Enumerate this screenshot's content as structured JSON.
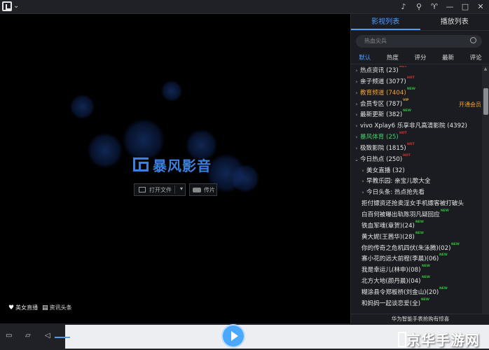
{
  "sidebar": {
    "tabs": [
      "影视列表",
      "播放列表"
    ],
    "search_placeholder": "热血尖兵",
    "filters": [
      "默认",
      "热度",
      "评分",
      "最新",
      "评论"
    ],
    "items": [
      {
        "label": "热点资讯 (23)",
        "arrow": "›",
        "badge": "HOT",
        "badge_type": "hot",
        "indent": 0
      },
      {
        "label": "亲子频道 (3077)",
        "arrow": "›",
        "badge": "HOT",
        "badge_type": "hot",
        "indent": 0
      },
      {
        "label": "教育频道 (7404)",
        "arrow": "›",
        "badge": "NEW",
        "badge_type": "new",
        "indent": 0,
        "color": "#f0a030"
      },
      {
        "label": "会员专区 (787)",
        "arrow": "›",
        "badge": "VIP",
        "badge_type": "vip",
        "indent": 0,
        "extra": "开通会员"
      },
      {
        "label": "最新更新 (382)",
        "arrow": "›",
        "badge": "NEW",
        "badge_type": "new",
        "indent": 0
      },
      {
        "label": "vivo Xplay6 乐享非凡高清影院 (4392)",
        "arrow": "›",
        "indent": 0
      },
      {
        "label": "暴风体育 (25)",
        "arrow": "›",
        "badge": "HOT",
        "badge_type": "hot",
        "indent": 0,
        "color": "#3fd16a"
      },
      {
        "label": "极致影院 (1815)",
        "arrow": "›",
        "badge": "HOT",
        "badge_type": "hot",
        "indent": 0
      },
      {
        "label": "今日热点 (250)",
        "arrow": "⌄",
        "badge": "HOT",
        "badge_type": "hot",
        "indent": 0
      },
      {
        "label": "美女直播 (32)",
        "arrow": "›",
        "indent": 1
      },
      {
        "label": "早教乐园: 亲宝儿歌大全",
        "arrow": "›",
        "indent": 1
      },
      {
        "label": "今日头条: 热点抢先看",
        "arrow": "›",
        "indent": 1
      },
      {
        "label": "拒付嫖资还抢卖淫女手机嫖客被打破头",
        "arrow": "",
        "indent": 2
      },
      {
        "label": "白百何被曝出轨陈羽凡疑回应",
        "arrow": "",
        "badge": "NEW",
        "badge_type": "new",
        "indent": 2
      },
      {
        "label": "铁血军魂(章贺)(24)",
        "arrow": "",
        "badge": "NEW",
        "badge_type": "new",
        "indent": 2
      },
      {
        "label": "黄大妮(王茜华)(28)",
        "arrow": "",
        "badge": "NEW",
        "badge_type": "new",
        "indent": 2
      },
      {
        "label": "你的传奇之危机四伏(朱泳腾)(02)",
        "arrow": "",
        "badge": "NEW",
        "badge_type": "new",
        "indent": 2
      },
      {
        "label": "寡小花的远大前程(李晨)(06)",
        "arrow": "",
        "badge": "NEW",
        "badge_type": "new",
        "indent": 2
      },
      {
        "label": "我是幸运儿(林申)(08)",
        "arrow": "",
        "badge": "NEW",
        "badge_type": "new",
        "indent": 2
      },
      {
        "label": "北方大地(颜丹晨)(04)",
        "arrow": "",
        "badge": "NEW",
        "badge_type": "new",
        "indent": 2
      },
      {
        "label": "糊涂县令郑板桥(刘金山)(20)",
        "arrow": "",
        "badge": "NEW",
        "badge_type": "new",
        "indent": 2
      },
      {
        "label": "和妈妈一起谈恋爱(全)",
        "arrow": "",
        "badge": "NEW",
        "badge_type": "new",
        "indent": 2
      }
    ],
    "promo": "华为智能手表抢购有惊喜"
  },
  "player": {
    "brand": "暴风影音",
    "open_file": "打开文件",
    "clip": "传片",
    "links": [
      "美女直播",
      "资讯头条"
    ]
  },
  "watermark": "京华手游网",
  "icons": {
    "titlebar": [
      "chevron-down-icon",
      "bell-icon",
      "pin-icon",
      "shirt-icon",
      "minimize-icon",
      "maximize-icon",
      "close-icon"
    ],
    "controls": [
      "playlist-icon",
      "folder-icon",
      "volume-icon",
      "play-icon"
    ]
  },
  "colors": {
    "accent": "#4a9eff",
    "hot": "#e0322a",
    "new": "#2fbf3a",
    "vip": "#e5a52a"
  }
}
